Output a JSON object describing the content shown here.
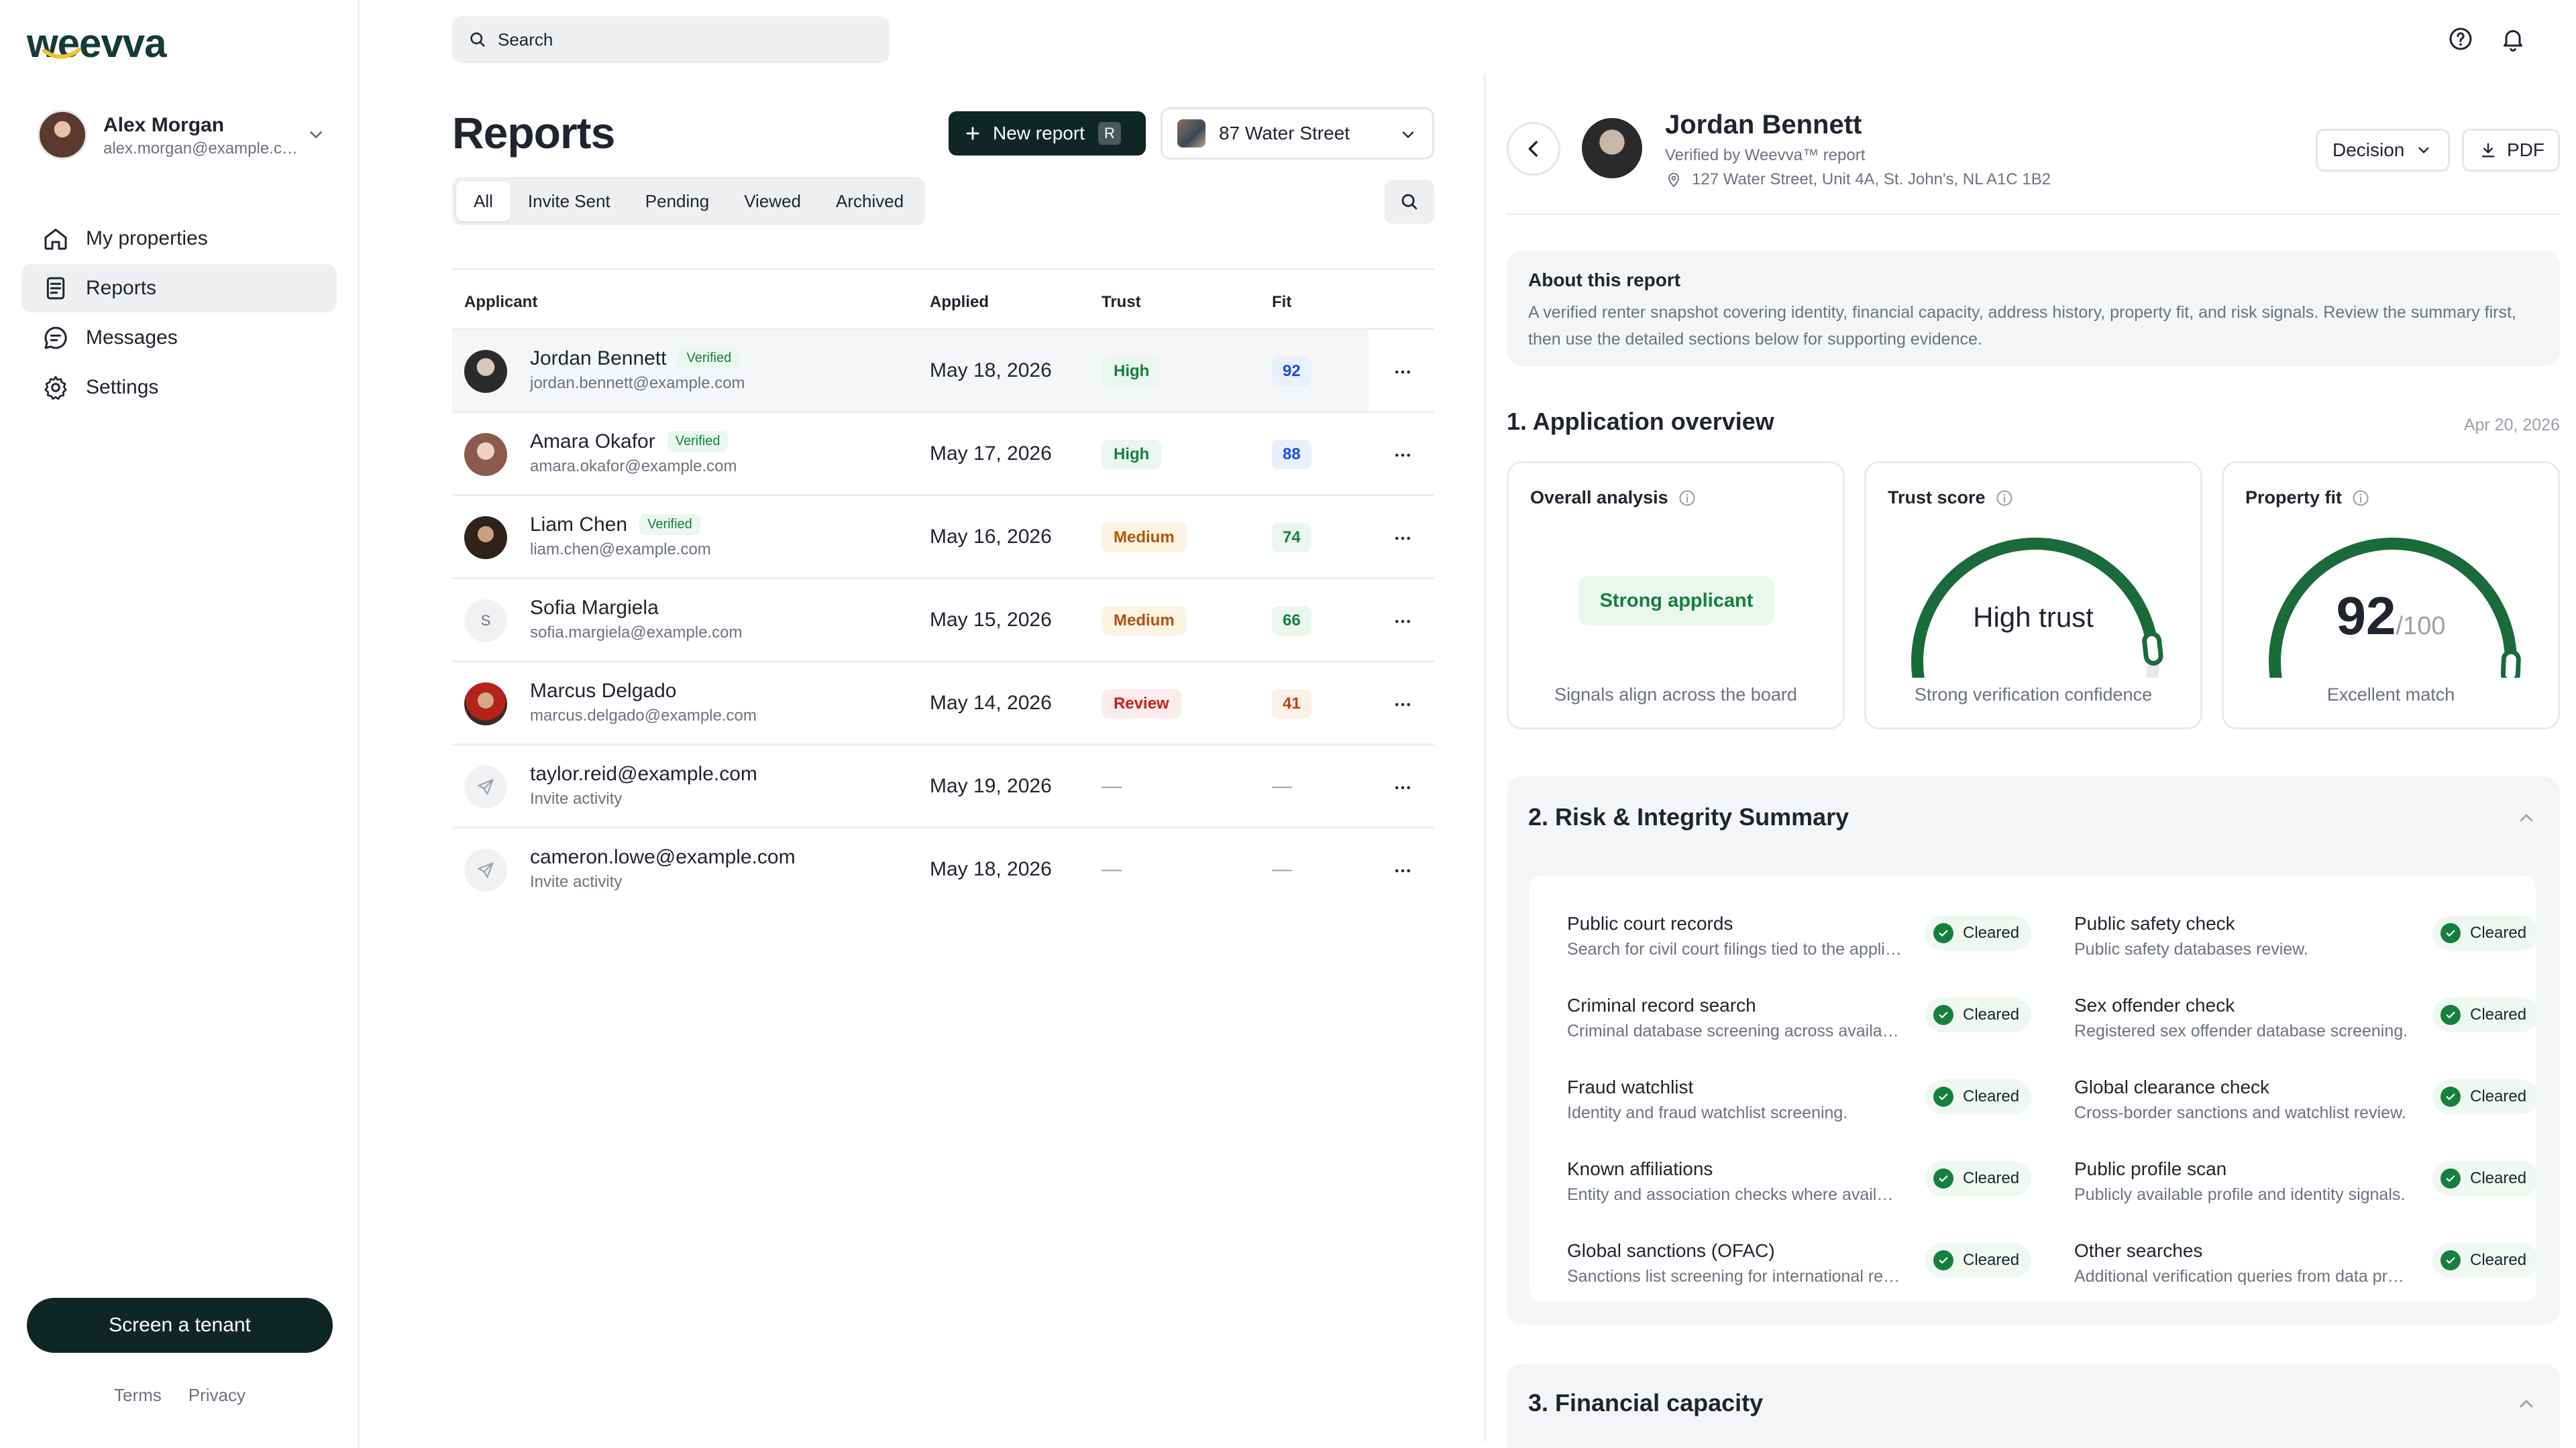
{
  "brand": {
    "logo_text": "weevva",
    "accent": "#0e2725",
    "green": "#15803d"
  },
  "user": {
    "name": "Alex Morgan",
    "email": "alex.morgan@example.com"
  },
  "nav": [
    {
      "label": "My properties",
      "icon": "home-icon"
    },
    {
      "label": "Reports",
      "icon": "report-icon",
      "active": true
    },
    {
      "label": "Messages",
      "icon": "chat-icon"
    },
    {
      "label": "Settings",
      "icon": "gear-icon"
    }
  ],
  "sidebar_footer": {
    "cta": "Screen a tenant",
    "terms": "Terms",
    "privacy": "Privacy"
  },
  "search": {
    "placeholder": "Search"
  },
  "reports": {
    "title": "Reports",
    "new_report": "New report",
    "new_report_shortcut": "R",
    "property": "87 Water Street",
    "tabs": [
      "All",
      "Invite Sent",
      "Pending",
      "Viewed",
      "Archived"
    ],
    "active_tab": "All",
    "columns": {
      "applicant": "Applicant",
      "applied": "Applied",
      "trust": "Trust",
      "fit": "Fit"
    },
    "rows": [
      {
        "name": "Jordan Bennett",
        "verified": "Verified",
        "email": "jordan.bennett@example.com",
        "applied": "May 18, 2026",
        "trust": "High",
        "fit": "92"
      },
      {
        "name": "Amara Okafor",
        "verified": "Verified",
        "email": "amara.okafor@example.com",
        "applied": "May 17, 2026",
        "trust": "High",
        "fit": "88"
      },
      {
        "name": "Liam Chen",
        "verified": "Verified",
        "email": "liam.chen@example.com",
        "applied": "May 16, 2026",
        "trust": "Medium",
        "fit": "74"
      },
      {
        "name": "Sofia Margiela",
        "initial": "S",
        "email": "sofia.margiela@example.com",
        "applied": "May 15, 2026",
        "trust": "Medium",
        "fit": "66"
      },
      {
        "name": "Marcus Delgado",
        "email": "marcus.delgado@example.com",
        "applied": "May 14, 2026",
        "trust": "Review",
        "fit": "41"
      },
      {
        "name": "taylor.reid@example.com",
        "email": "Invite activity",
        "applied": "May 19, 2026",
        "trust": "—",
        "fit": "—"
      },
      {
        "name": "cameron.lowe@example.com",
        "email": "Invite activity",
        "applied": "May 18, 2026",
        "trust": "—",
        "fit": "—"
      }
    ]
  },
  "detail": {
    "name": "Jordan Bennett",
    "verified_by": "Verified by Weevva™ report",
    "address": "127 Water Street, Unit 4A, St. John's, NL A1C 1B2",
    "decision": "Decision",
    "pdf": "PDF",
    "about_title": "About this report",
    "about_text": "A verified renter snapshot covering identity, financial capacity, address history, property fit, and risk signals. Review the summary first, then use the detailed sections below for supporting evidence.",
    "overview_title": "1. Application overview",
    "overview_date": "Apr 20, 2026",
    "cards": {
      "analysis": {
        "title": "Overall analysis",
        "pill": "Strong applicant",
        "sub": "Signals align across the board"
      },
      "trust": {
        "title": "Trust score",
        "value": "High trust",
        "level": 0.88,
        "sub": "Strong verification confidence"
      },
      "fit": {
        "title": "Property fit",
        "score": "92",
        "out_of": "/100",
        "level": 0.92,
        "sub": "Excellent match"
      }
    },
    "risk_title": "2. Risk & Integrity Summary",
    "cleared_label": "Cleared",
    "risk_items": [
      {
        "name": "Public court records",
        "desc": "Search for civil court filings tied to the applicant."
      },
      {
        "name": "Public safety check",
        "desc": "Public safety databases review."
      },
      {
        "name": "Criminal record search",
        "desc": "Criminal database screening across available jurisdictions."
      },
      {
        "name": "Sex offender check",
        "desc": "Registered sex offender database screening."
      },
      {
        "name": "Fraud watchlist",
        "desc": "Identity and fraud watchlist screening."
      },
      {
        "name": "Global clearance check",
        "desc": "Cross-border sanctions and watchlist review."
      },
      {
        "name": "Known affiliations",
        "desc": "Entity and association checks where available."
      },
      {
        "name": "Public profile scan",
        "desc": "Publicly available profile and identity signals."
      },
      {
        "name": "Global sanctions (OFAC)",
        "desc": "Sanctions list screening for international records."
      },
      {
        "name": "Other searches",
        "desc": "Additional verification queries from data providers."
      }
    ],
    "financial_title": "3. Financial capacity"
  }
}
